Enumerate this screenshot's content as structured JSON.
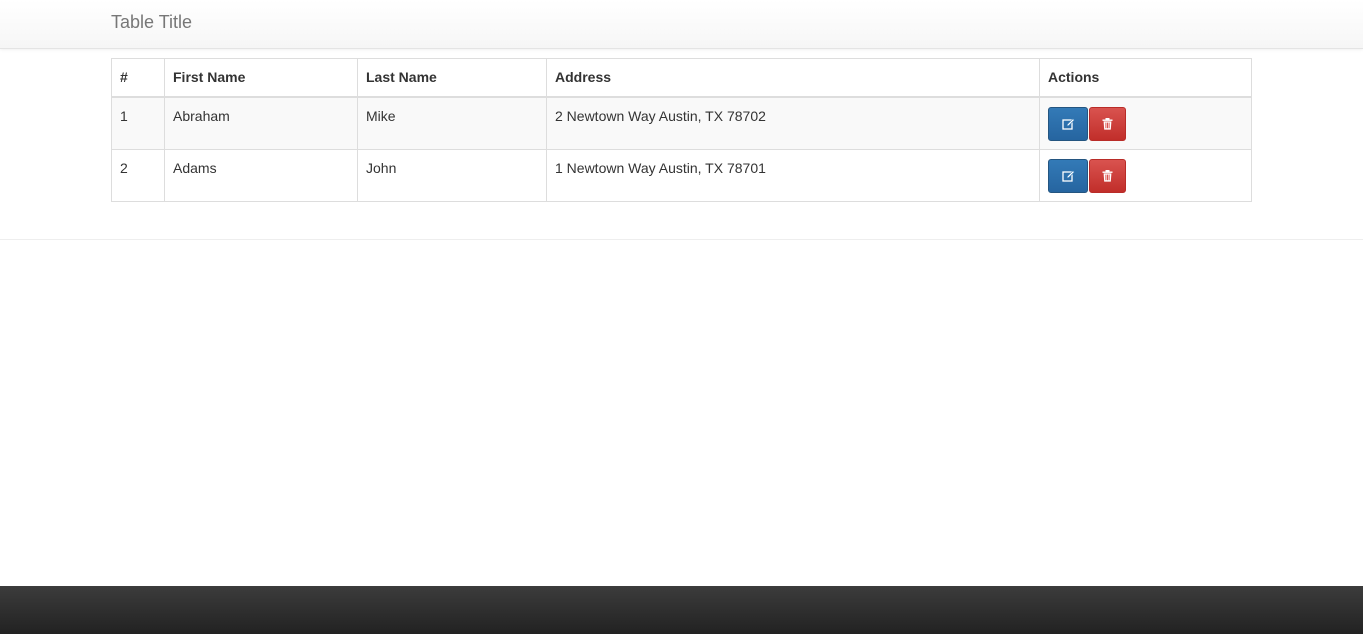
{
  "navbar": {
    "title": "Table Title"
  },
  "table": {
    "headers": [
      "#",
      "First Name",
      "Last Name",
      "Address",
      "Actions"
    ],
    "rows": [
      {
        "num": "1",
        "first": "Abraham",
        "last": "Mike",
        "address": "2 Newtown Way Austin, TX 78702"
      },
      {
        "num": "2",
        "first": "Adams",
        "last": "John",
        "address": "1 Newtown Way Austin, TX 78701"
      }
    ],
    "actions": {
      "edit_icon": "edit-icon",
      "delete_icon": "trash-icon"
    }
  },
  "colors": {
    "edit": "#337ab7",
    "delete": "#d9534f",
    "footer": "#2b2b2b"
  }
}
